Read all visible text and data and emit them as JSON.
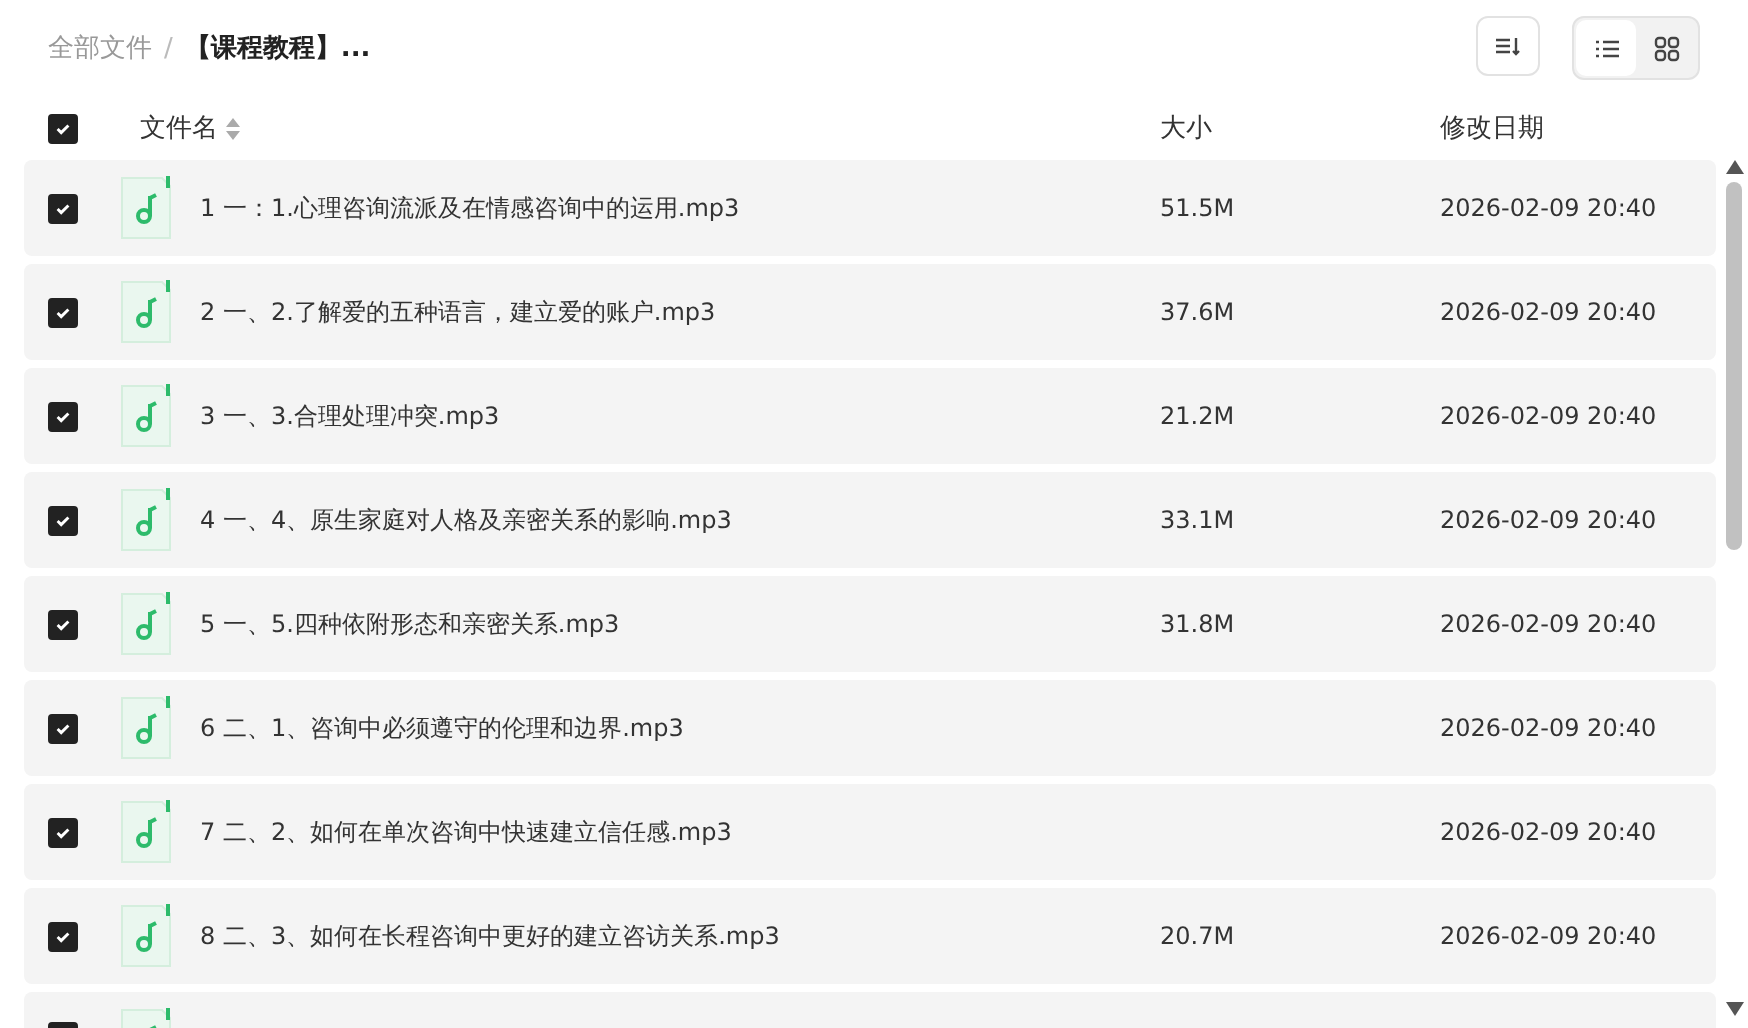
{
  "breadcrumb": [
    {
      "label": "全部文件",
      "current": false
    },
    {
      "label": "【课程教程】...",
      "current": true
    }
  ],
  "breadcrumb_separator": "/",
  "view_toggle": [
    {
      "kind": "list",
      "selected": true
    },
    {
      "kind": "grid",
      "selected": false
    }
  ],
  "table": {
    "select_all": {
      "checked": true
    },
    "columns": [
      {
        "label": "文件名",
        "sortable": true
      },
      {
        "label": "大小",
        "sortable": false
      },
      {
        "label": "修改日期",
        "sortable": false
      }
    ],
    "rows": [
      {
        "checked": true,
        "name": "1 一：1.心理咨询流派及在情感咨询中的运用.mp3",
        "size": "51.5M",
        "modified": "2026-02-09 20:40"
      },
      {
        "checked": true,
        "name": "2 一、2.了解爱的五种语言，建立爱的账户.mp3",
        "size": "37.6M",
        "modified": "2026-02-09 20:40"
      },
      {
        "checked": true,
        "name": "3 一、3.合理处理冲突.mp3",
        "size": "21.2M",
        "modified": "2026-02-09 20:40"
      },
      {
        "checked": true,
        "name": "4 一、4、原生家庭对人格及亲密关系的影响.mp3",
        "size": "33.1M",
        "modified": "2026-02-09 20:40"
      },
      {
        "checked": true,
        "name": "5 一、5.四种依附形态和亲密关系.mp3",
        "size": "31.8M",
        "modified": "2026-02-09 20:40"
      },
      {
        "checked": true,
        "name": "6 二、1、咨询中必须遵守的伦理和边界.mp3",
        "modified": "2026-02-09 20:40"
      },
      {
        "checked": true,
        "name": "7 二、2、如何在单次咨询中快速建立信任感.mp3",
        "modified": "2026-02-09 20:40"
      },
      {
        "checked": true,
        "name": "8 二、3、如何在长程咨询中更好的建立咨访关系.mp3",
        "size": "20.7M",
        "modified": "2026-02-09 20:40"
      },
      {
        "checked": true
      }
    ]
  }
}
